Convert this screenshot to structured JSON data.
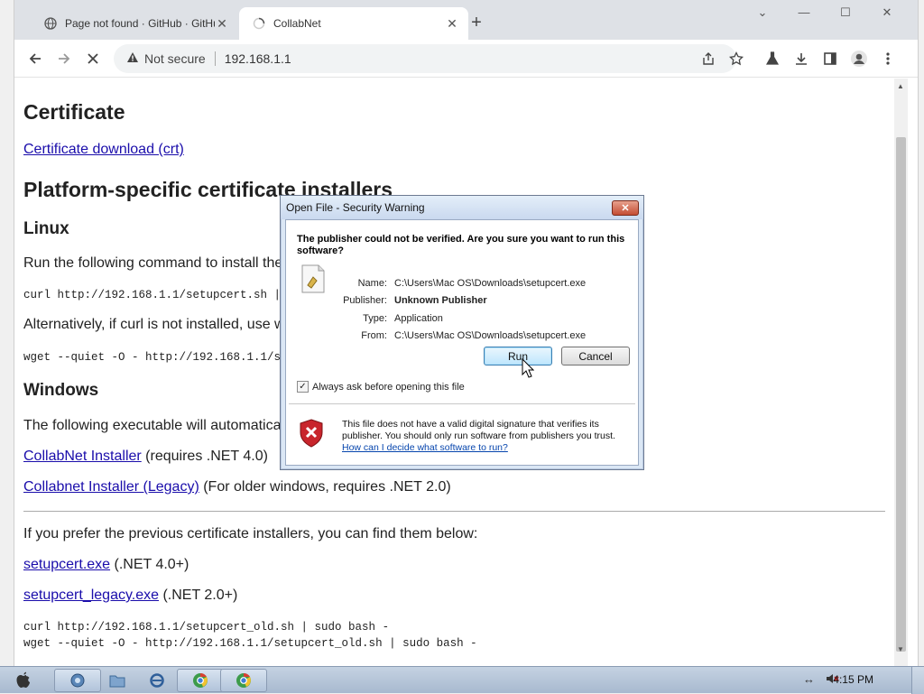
{
  "browser": {
    "tabs": [
      {
        "title": "Page not found · GitHub · GitHub",
        "active": false
      },
      {
        "title": "CollabNet",
        "active": true
      }
    ],
    "address": {
      "security_label": "Not secure",
      "url": "192.168.1.1"
    }
  },
  "page": {
    "h_certificate": "Certificate",
    "cert_link": "Certificate download (crt)",
    "h_platform": "Platform-specific certificate installers",
    "h_linux": "Linux",
    "linux_text": "Run the following command to install the",
    "linux_cmd": "curl http://192.168.1.1/setupcert.sh | s",
    "alt_text": "Alternatively, if curl is not installed, use w",
    "wget_cmd": "wget --quiet -O - http://192.168.1.1/set",
    "h_windows": "Windows",
    "windows_text": "The following executable will automatica",
    "installer_link": "CollabNet Installer",
    "installer_note": " (requires .NET 4.0)",
    "legacy_link": "Collabnet Installer (Legacy)",
    "legacy_note": " (For older windows, requires .NET 2.0)",
    "prev_text": "If you prefer the previous certificate installers, you can find them below:",
    "setupcert_link": "setupcert.exe",
    "setupcert_note": " (.NET 4.0+)",
    "setupcert_legacy_link": "setupcert_legacy.exe",
    "setupcert_legacy_note": " (.NET 2.0+)",
    "old_curl_cmd": "curl http://192.168.1.1/setupcert_old.sh | sudo bash -",
    "old_wget_cmd": "wget --quiet -O - http://192.168.1.1/setupcert_old.sh | sudo bash -"
  },
  "dialog": {
    "title": "Open File - Security Warning",
    "question": "The publisher could not be verified.  Are you sure you want to run this software?",
    "fields": {
      "name_label": "Name:",
      "name_value": "C:\\Users\\Mac OS\\Downloads\\setupcert.exe",
      "publisher_label": "Publisher:",
      "publisher_value": "Unknown Publisher",
      "type_label": "Type:",
      "type_value": "Application",
      "from_label": "From:",
      "from_value": "C:\\Users\\Mac OS\\Downloads\\setupcert.exe"
    },
    "run_label": "Run",
    "cancel_label": "Cancel",
    "checkbox_label": "Always ask before opening this file",
    "checkbox_checked": true,
    "warning_text": "This file does not have a valid digital signature that verifies its publisher.  You should only run software from publishers you trust.",
    "help_link": "How can I decide what software to run?"
  },
  "taskbar": {
    "clock": "4:15 PM"
  },
  "colors": {
    "link": "#1a0dab",
    "tabstrip": "#dee1e6",
    "dialog_frame": "#dbe7f5"
  }
}
